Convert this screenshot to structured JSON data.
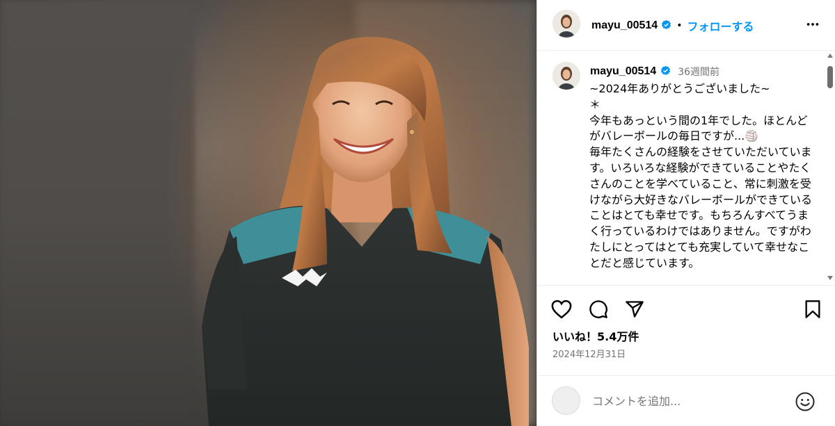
{
  "post": {
    "username": "mayu_00514",
    "follow_label": "フォローする",
    "separator": "•",
    "caption": {
      "time_ago": "36週間前",
      "text": "~2024年ありがとうございました~\n＊\n今年もあっという間の1年でした。ほとんどがバレーボールの毎日ですが...🏐\n毎年たくさんの経験をさせていただいています。いろいろな経験ができていることやたくさんのことを学べていること、常に刺激を受けながら大好きなバレーボールができていることはとても幸せです。もちろんすべてうまく行っているわけではありません。ですがわたしにとってはとても充実していて幸せなことだと感じています。"
    },
    "likes_label": "いいね！5.4万件",
    "date": "2024年12月31日",
    "comment_placeholder": "コメントを追加...",
    "icons": {
      "verified": "verified-badge-icon",
      "more": "more-options-icon",
      "like": "heart-icon",
      "comment": "comment-bubble-icon",
      "share": "paper-plane-icon",
      "save": "bookmark-icon",
      "emoji": "emoji-smile-icon"
    },
    "colors": {
      "accent": "#0095f6",
      "verified": "#0095f6",
      "secondary_text": "#737373",
      "divider": "#efefef"
    }
  }
}
